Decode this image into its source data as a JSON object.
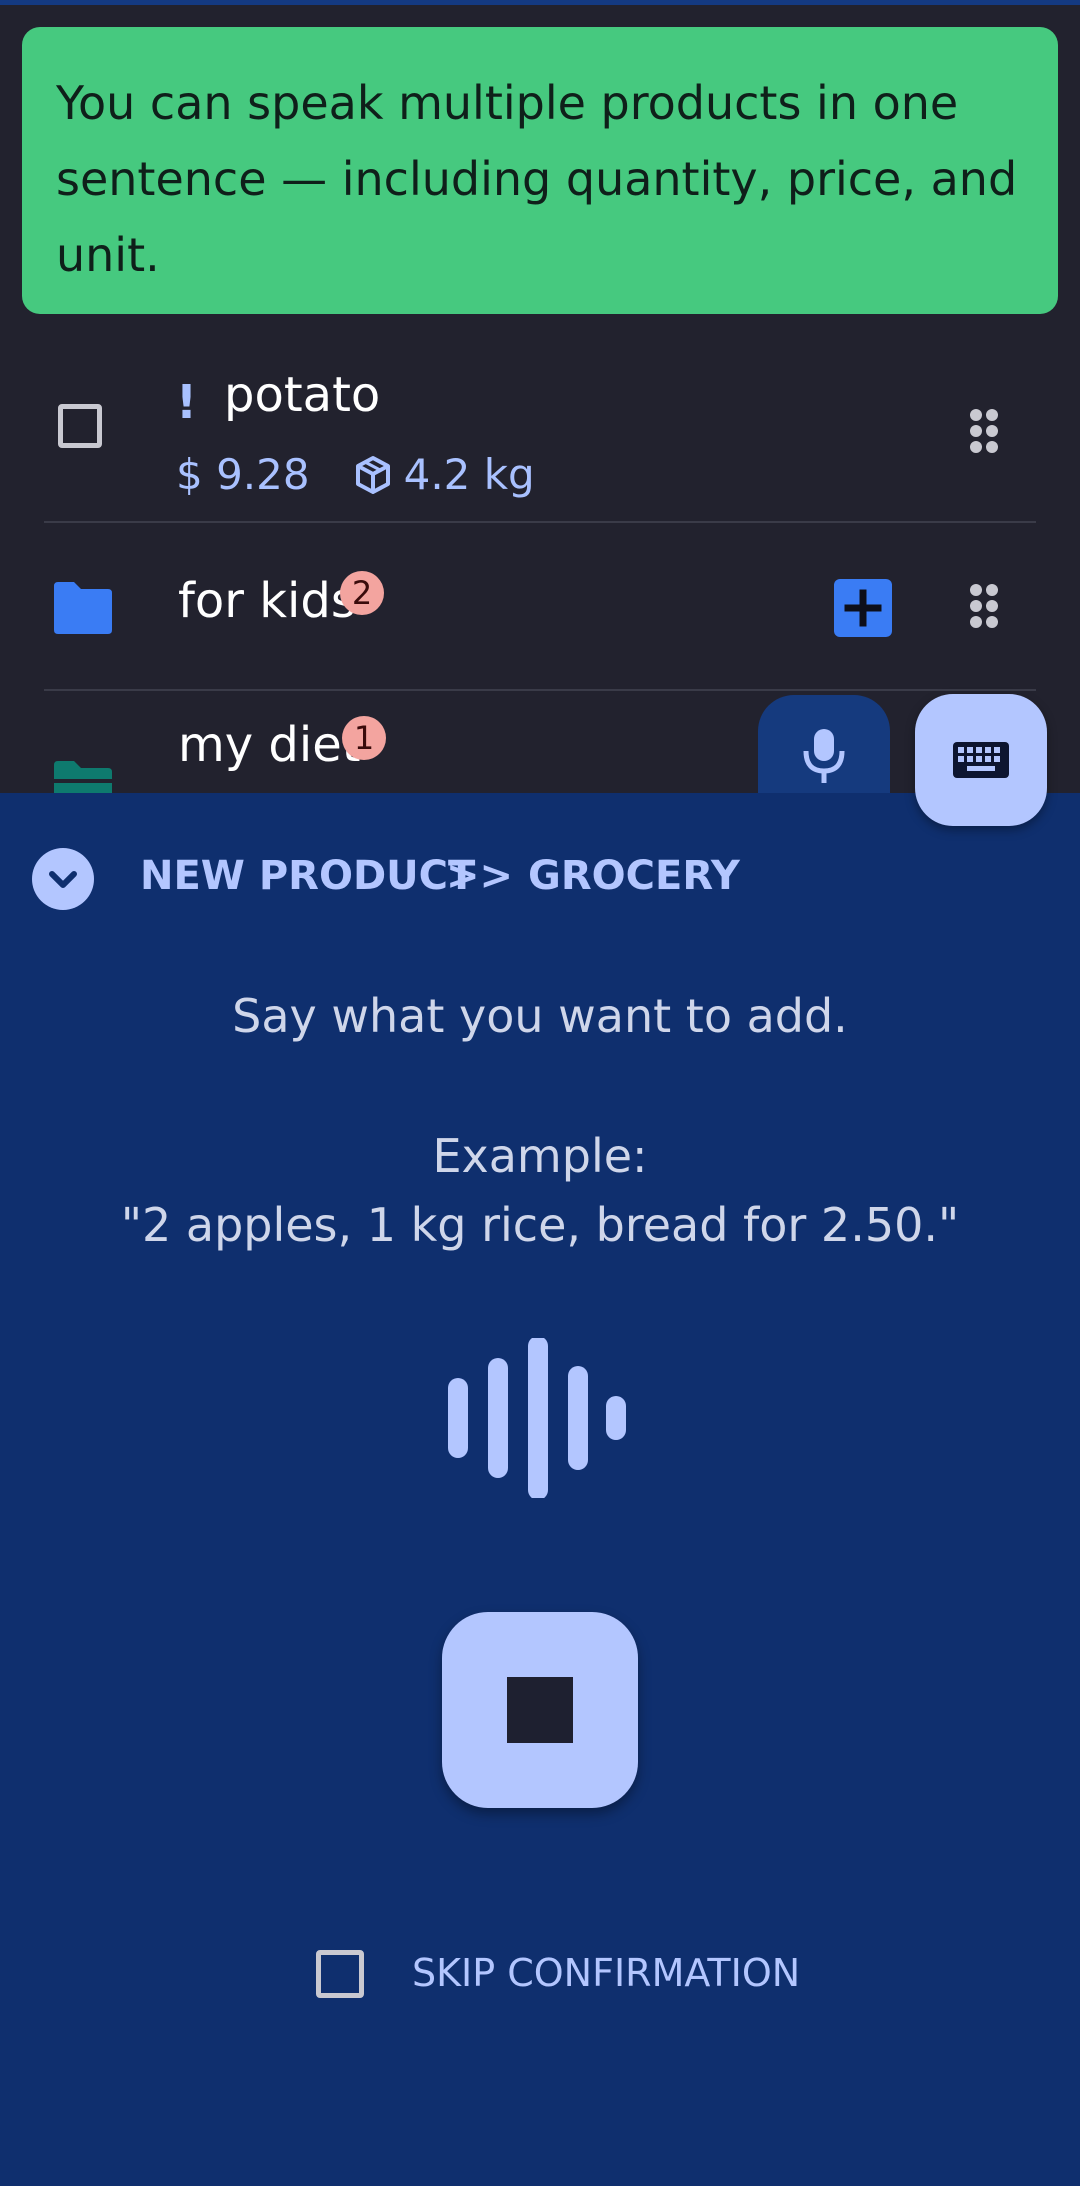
{
  "tip": {
    "text": "You can speak multiple products in one sentence — including quantity, price, and unit."
  },
  "items": [
    {
      "name": "potato",
      "priority_mark": "!",
      "price": "$ 9.28",
      "quantity": "4.2 kg"
    }
  ],
  "folders": [
    {
      "name": "for kids",
      "count": "2",
      "color": "#3a7cf4"
    },
    {
      "name": "my diet",
      "count": "1",
      "color": "#0e7a6e"
    }
  ],
  "panel": {
    "breadcrumb": {
      "first": "NEW PRODUCT",
      "separator": ">>",
      "second": "GROCERY"
    },
    "prompt": "Say what you want to add.",
    "example_label": "Example:",
    "example_text": "\"2 apples, 1 kg rice, bread for 2.50.\"",
    "skip_label": "SKIP CONFIRMATION"
  },
  "icons": {
    "tip": "none",
    "checkbox": "checkbox-empty",
    "quantity": "package-icon",
    "drag": "drag-handle-icon",
    "folder": "folder-icon",
    "add": "plus-icon",
    "mic": "mic-icon",
    "keyboard": "keyboard-icon",
    "collapse": "chevron-down-icon",
    "wave": "sound-wave-icon",
    "stop": "stop-icon"
  },
  "colors": {
    "accent": "#b3c6ff",
    "panel_bg": "#0f2f6e",
    "list_bg": "#22222e",
    "tip_bg": "#46c97f",
    "badge_bg": "#f3a49f"
  }
}
